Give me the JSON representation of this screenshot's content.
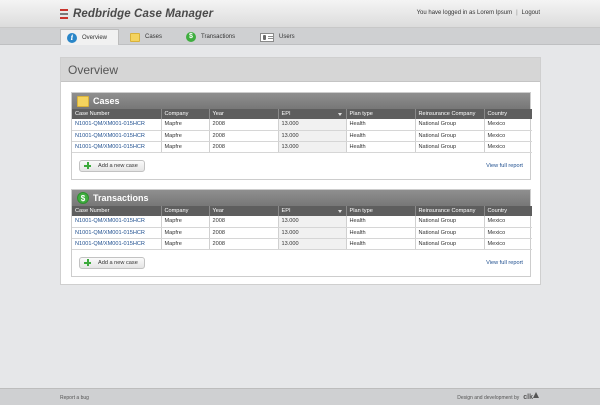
{
  "app": {
    "title": "Redbridge Case Manager",
    "logo_icon": "redbridge-logo-icon"
  },
  "user": {
    "logged_text": "You have logged in as Lorem Ipsum",
    "logout": "Logout"
  },
  "nav": {
    "tabs": [
      {
        "label": "Overview",
        "icon": "info-icon",
        "active": true
      },
      {
        "label": "Cases",
        "icon": "folder-icon",
        "active": false
      },
      {
        "label": "Transactions",
        "icon": "dollar-icon",
        "active": false
      },
      {
        "label": "Users",
        "icon": "users-icon",
        "active": false
      }
    ],
    "search": {
      "value": "",
      "placeholder": ""
    }
  },
  "page": {
    "title": "Overview"
  },
  "columns": [
    "Case Number",
    "Company",
    "Year",
    "EPI",
    "Plan type",
    "Reinsurance Company",
    "Country"
  ],
  "cases": {
    "title": "Cases",
    "rows": [
      [
        "N1001-QM/XM001-015HCR",
        "Mapfre",
        "2008",
        "13.000",
        "Health",
        "National Group",
        "Mexico"
      ],
      [
        "N1001-QM/XM001-015HCR",
        "Mapfre",
        "2008",
        "13.000",
        "Health",
        "National Group",
        "Mexico"
      ],
      [
        "N1001-QM/XM001-015HCR",
        "Mapfre",
        "2008",
        "13.000",
        "Health",
        "National Group",
        "Mexico"
      ]
    ],
    "add_label": "Add a new case",
    "view_full": "View full report"
  },
  "transactions": {
    "title": "Transactions",
    "rows": [
      [
        "N1001-QM/XM001-015HCR",
        "Mapfre",
        "2008",
        "13.000",
        "Health",
        "National Group",
        "Mexico"
      ],
      [
        "N1001-QM/XM001-015HCR",
        "Mapfre",
        "2008",
        "13.000",
        "Health",
        "National Group",
        "Mexico"
      ],
      [
        "N1001-QM/XM001-015HCR",
        "Mapfre",
        "2008",
        "13.000",
        "Health",
        "National Group",
        "Mexico"
      ]
    ],
    "add_label": "Add a new case",
    "view_full": "View full report"
  },
  "footer": {
    "report_bug": "Report a bug",
    "credit": "Design and development by",
    "brand": "clk"
  },
  "colors": {
    "link": "#1f4f8f",
    "section_header": "#808080",
    "table_header": "#5e5e5e",
    "add_icon": "#3caa3c"
  }
}
